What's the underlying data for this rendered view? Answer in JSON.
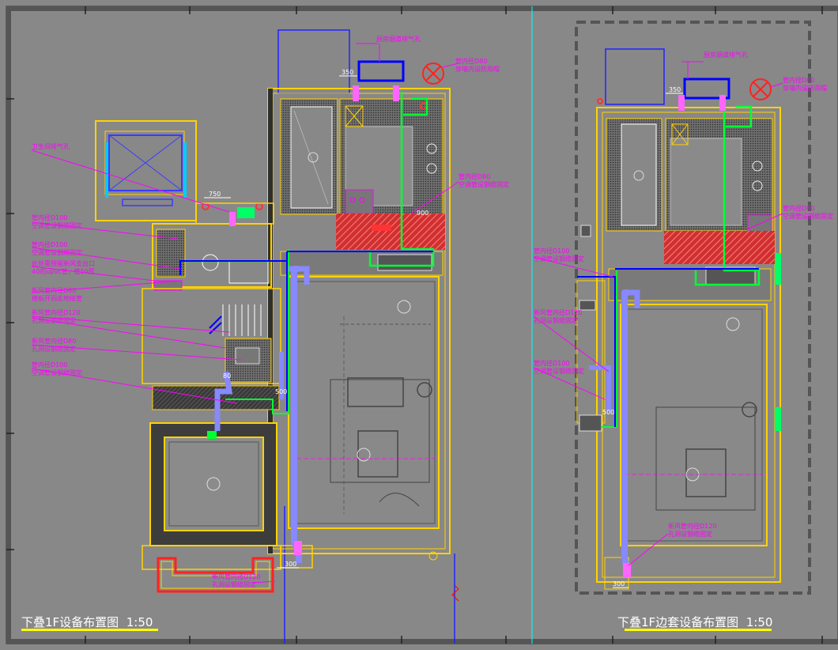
{
  "left_plan": {
    "title": "下叠1F设备布置图",
    "scale": "1:50",
    "dims": {
      "d350": "350",
      "d750": "750",
      "d900": "900",
      "d300": "300",
      "d80": "80",
      "d500": "500"
    },
    "notes": [
      "卫生间排气孔",
      "管内径D100",
      "空调管设钢缆固定",
      "管内径D100",
      "空调管设钢缆固定",
      "此处需预留新风支出口",
      "40的upvc管，管50厚",
      "新风管内径D80",
      "楼板开洞走地接管",
      "新风管内径D120",
      "孔洞设钢缆固定",
      "新风管内径D80",
      "孔洞设钢缆固定",
      "管内径D100",
      "空调管设钢缆固定",
      "新风管内径D120",
      "孔洞设钢缆固定",
      "厨房烟道排气孔",
      "管内径D80",
      "穿墙内设防雨帽",
      "管内径D80",
      "空调管设钢缆固定"
    ]
  },
  "right_plan": {
    "title": "下叠1F边套设备布置图",
    "scale": "1:50",
    "dims": {
      "d350": "350",
      "d300": "300",
      "d500": "500"
    },
    "notes": [
      "厨房烟道排气孔",
      "管内径D80",
      "穿墙内设防雨帽",
      "管内径D80",
      "空调管设钢缆固定",
      "管内径D100",
      "空调管设钢缆固定",
      "新风管内径D120",
      "孔洞设钢缆固定",
      "管内径D100",
      "空调管设钢缆固定",
      "新风管内径D120",
      "孔洞设钢缆固定"
    ]
  },
  "colors": {
    "background": "#888888",
    "wall": "#ffd200",
    "wall_dark": "#333333",
    "duct_fresh": "#7777ff",
    "duct_ac": "#00ff33",
    "pipe_blue": "#0000ff",
    "annotation": "#ff00ff",
    "hatch_red": "#cc2222",
    "title_underline": "#ffff00",
    "sheet_divider": "#00ffff"
  }
}
